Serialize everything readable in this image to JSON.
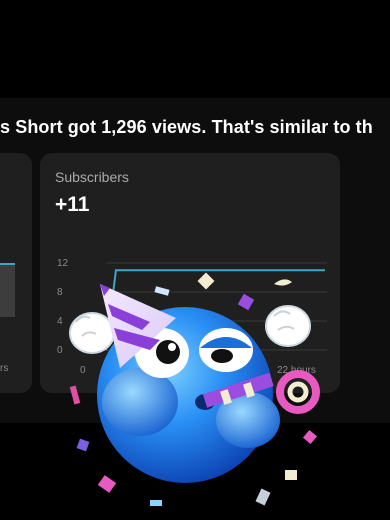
{
  "headline": {
    "text": "s Short got 1,296 views. That's similar to th"
  },
  "left_card": {
    "tick_label": "rs"
  },
  "subscribers_card": {
    "title": "Subscribers",
    "value": "+11"
  },
  "chart_data": {
    "type": "line",
    "y_ticks": [
      "12",
      "8",
      "4",
      "0"
    ],
    "x_tick_labels": [
      "0",
      "22 hours"
    ],
    "ylim": [
      0,
      12
    ],
    "series": [
      {
        "x": [
          0,
          1,
          22
        ],
        "values": [
          0,
          11,
          11
        ]
      }
    ],
    "grid": true,
    "line_color": "#3ea6c8"
  },
  "colors": {
    "background": "#000000",
    "card": "#1f1f1f",
    "accent_line": "#3ea6c8",
    "emoji_blue": "#1f86f0"
  },
  "sticker": {
    "icon": "party-emoji-icon"
  }
}
